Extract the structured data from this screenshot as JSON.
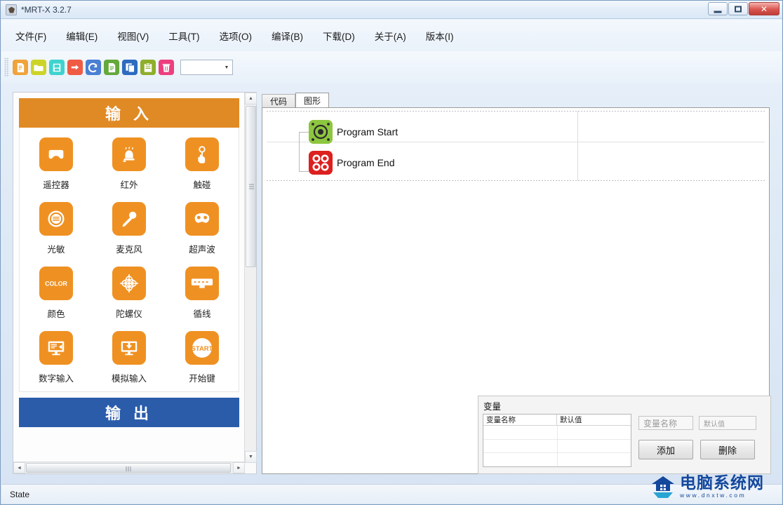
{
  "window": {
    "title": "*MRT-X 3.2.7",
    "app_icon": "app-logo-icon",
    "minimize": "–",
    "maximize": "☐",
    "close": "✕"
  },
  "menubar": {
    "items": [
      {
        "label": "文件(F)",
        "name": "menu-file"
      },
      {
        "label": "编辑(E)",
        "name": "menu-edit"
      },
      {
        "label": "视图(V)",
        "name": "menu-view"
      },
      {
        "label": "工具(T)",
        "name": "menu-tools"
      },
      {
        "label": "选项(O)",
        "name": "menu-options"
      },
      {
        "label": "编译(B)",
        "name": "menu-build"
      },
      {
        "label": "下载(D)",
        "name": "menu-download"
      },
      {
        "label": "关于(A)",
        "name": "menu-about"
      },
      {
        "label": "版本(I)",
        "name": "menu-version"
      }
    ]
  },
  "toolbar": {
    "buttons": [
      {
        "name": "new-file-icon",
        "color": "#efa33a"
      },
      {
        "name": "open-folder-icon",
        "color": "#cdd427"
      },
      {
        "name": "save-file-icon",
        "color": "#3fd3cf"
      },
      {
        "name": "import-icon",
        "color": "#ef5b43"
      },
      {
        "name": "undo-icon",
        "color": "#4a7fd4"
      },
      {
        "name": "compile-icon",
        "color": "#64a93c"
      },
      {
        "name": "copy-icon",
        "color": "#2d6bbf"
      },
      {
        "name": "paste-icon",
        "color": "#8fae2b"
      },
      {
        "name": "delete-icon",
        "color": "#ec3f80"
      }
    ],
    "combo": {
      "value": "",
      "placeholder": "",
      "arrow": "▼"
    }
  },
  "palette": {
    "sections": [
      {
        "name": "input",
        "title": "输 入",
        "color": "#e08a25",
        "items": [
          {
            "label": "遥控器",
            "icon": "gamepad-icon"
          },
          {
            "label": "红外",
            "icon": "infrared-icon"
          },
          {
            "label": "触碰",
            "icon": "touch-icon"
          },
          {
            "label": "光敏",
            "icon": "light-sensor-icon"
          },
          {
            "label": "麦克风",
            "icon": "microphone-icon"
          },
          {
            "label": "超声波",
            "icon": "ultrasonic-icon"
          },
          {
            "label": "颜色",
            "icon": "color-sensor-icon"
          },
          {
            "label": "陀螺仪",
            "icon": "gyroscope-icon"
          },
          {
            "label": "循线",
            "icon": "line-follow-icon"
          },
          {
            "label": "数字输入",
            "icon": "digital-input-icon"
          },
          {
            "label": "模拟输入",
            "icon": "analog-input-icon"
          },
          {
            "label": "开始键",
            "icon": "start-button-icon"
          }
        ]
      },
      {
        "name": "output",
        "title": "输 出",
        "color": "#2a5caa",
        "items": []
      }
    ],
    "scroll": {
      "up": "▲",
      "down": "▼",
      "left": "◄",
      "right": "►"
    }
  },
  "editor": {
    "tabs": [
      {
        "label": "代码",
        "name": "tab-code",
        "active": false
      },
      {
        "label": "图形",
        "name": "tab-graphic",
        "active": true
      }
    ],
    "nodes": [
      {
        "label": "Program Start",
        "icon": "program-start-icon",
        "color": "#8dc63f"
      },
      {
        "label": "Program End",
        "icon": "program-end-icon",
        "color": "#dd1f1f"
      }
    ]
  },
  "variables": {
    "title": "变量",
    "columns": [
      "变量名称",
      "默认值"
    ],
    "rows": [],
    "name_input": {
      "value": "",
      "placeholder": "变量名称"
    },
    "value_input": {
      "value": "",
      "placeholder": "默认值"
    },
    "add_button": "添加",
    "delete_button": "删除"
  },
  "statusbar": {
    "text": "State"
  },
  "watermark": {
    "site": "电脑系统网",
    "url": "www.dnxtw.com"
  }
}
